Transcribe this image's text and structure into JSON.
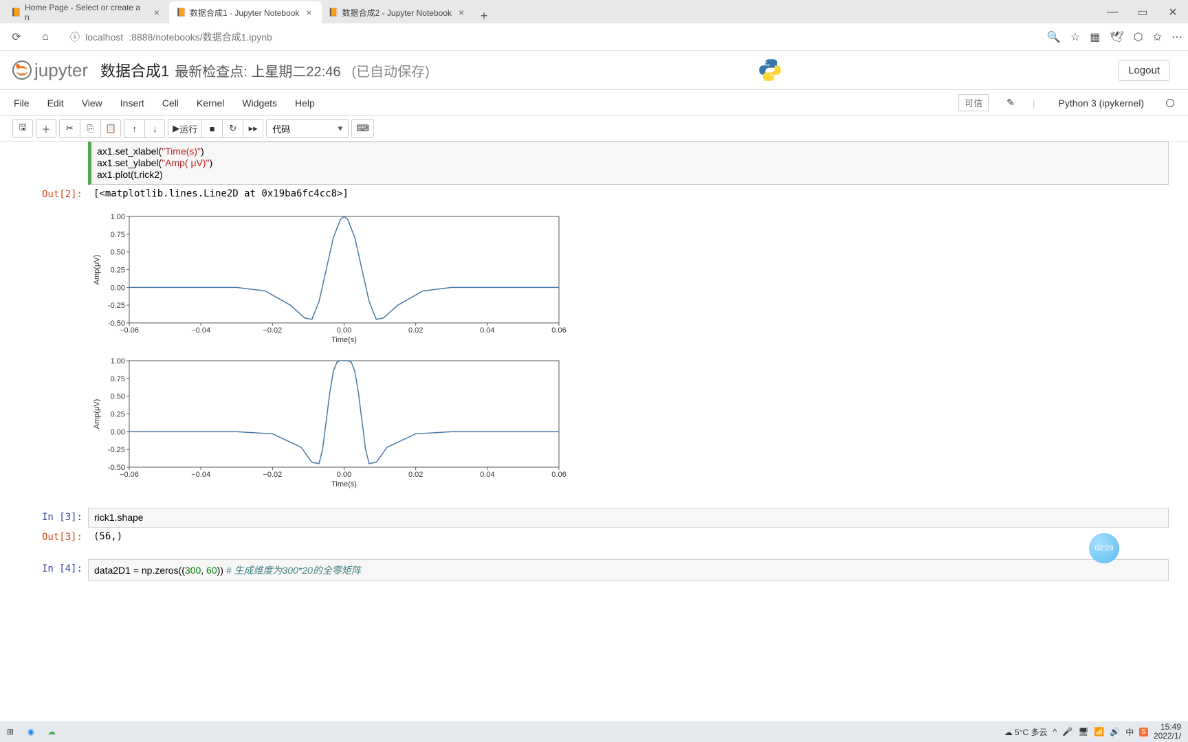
{
  "browser": {
    "tabs": [
      {
        "title": "Home Page - Select or create a n",
        "active": false,
        "icon": "jupyter"
      },
      {
        "title": "数据合成1 - Jupyter Notebook",
        "active": true,
        "icon": "jupyter"
      },
      {
        "title": "数据合成2 - Jupyter Notebook",
        "active": false,
        "icon": "jupyter"
      }
    ],
    "url_host": "localhost",
    "url_port_path": ":8888/notebooks/数据合成1.ipynb"
  },
  "jupyter": {
    "logo_text": "jupyter",
    "title": "数据合成1",
    "checkpoint": "最新检查点: 上星期二22:46",
    "autosave": "(已自动保存)",
    "logout": "Logout",
    "menu": [
      "File",
      "Edit",
      "View",
      "Insert",
      "Cell",
      "Kernel",
      "Widgets",
      "Help"
    ],
    "trusted": "可信",
    "kernel": "Python 3 (ipykernel)",
    "toolbar": {
      "run": "运行",
      "celltype": "代码"
    }
  },
  "code": {
    "line1a": "ax1.set_xlabel(",
    "str1": "\"Time(s)\"",
    "line1b": ")",
    "line2a": "ax1.set_ylabel(",
    "str2": "\"Amp( μV)\"",
    "line2b": ")",
    "line3": "ax1.plot(t,rick2)"
  },
  "prompts": {
    "out2": "Out[2]:",
    "in3": "In  [3]:",
    "out3": "Out[3]:",
    "in4": "In  [4]:"
  },
  "outputs": {
    "out2_text": "[<matplotlib.lines.Line2D at 0x19ba6fc4cc8>]",
    "out3_text": "(56,)"
  },
  "cell3_code": "rick1.shape",
  "cell4": {
    "prefix": "data2D1 = np.zeros((",
    "n1": "300",
    "comma": ", ",
    "n2": "60",
    "suffix": "))     ",
    "comment": "# 生成维度为300*20的全零矩阵"
  },
  "chart_data": [
    {
      "type": "line",
      "xlabel": "Time(s)",
      "ylabel": "Amp(μV)",
      "xlim": [
        -0.06,
        0.06
      ],
      "ylim": [
        -0.5,
        1.0
      ],
      "xticks": [
        -0.06,
        -0.04,
        -0.02,
        0.0,
        0.02,
        0.04,
        0.06
      ],
      "yticks": [
        -0.5,
        -0.25,
        0.0,
        0.25,
        0.5,
        0.75,
        1.0
      ],
      "x": [
        -0.06,
        -0.05,
        -0.04,
        -0.03,
        -0.022,
        -0.015,
        -0.011,
        -0.009,
        -0.007,
        -0.005,
        -0.003,
        -0.001,
        0.0,
        0.001,
        0.003,
        0.005,
        0.007,
        0.009,
        0.011,
        0.015,
        0.022,
        0.03,
        0.04,
        0.05,
        0.06
      ],
      "values": [
        0.0,
        0.0,
        0.0,
        0.0,
        -0.05,
        -0.25,
        -0.43,
        -0.45,
        -0.2,
        0.25,
        0.7,
        0.96,
        1.0,
        0.96,
        0.7,
        0.25,
        -0.2,
        -0.45,
        -0.43,
        -0.25,
        -0.05,
        0.0,
        0.0,
        0.0,
        0.0
      ]
    },
    {
      "type": "line",
      "xlabel": "Time(s)",
      "ylabel": "Amp(μV)",
      "xlim": [
        -0.06,
        0.06
      ],
      "ylim": [
        -0.5,
        1.0
      ],
      "xticks": [
        -0.06,
        -0.04,
        -0.02,
        0.0,
        0.02,
        0.04,
        0.06
      ],
      "yticks": [
        -0.5,
        -0.25,
        0.0,
        0.25,
        0.5,
        0.75,
        1.0
      ],
      "x": [
        -0.06,
        -0.05,
        -0.04,
        -0.03,
        -0.02,
        -0.012,
        -0.009,
        -0.007,
        -0.006,
        -0.005,
        -0.004,
        -0.003,
        -0.002,
        -0.001,
        0.0,
        0.001,
        0.002,
        0.003,
        0.004,
        0.005,
        0.006,
        0.007,
        0.009,
        0.012,
        0.02,
        0.03,
        0.04,
        0.05,
        0.06
      ],
      "values": [
        0.0,
        0.0,
        0.0,
        0.0,
        -0.03,
        -0.22,
        -0.43,
        -0.45,
        -0.25,
        0.15,
        0.55,
        0.85,
        0.98,
        1.0,
        1.0,
        1.0,
        0.98,
        0.85,
        0.55,
        0.15,
        -0.25,
        -0.45,
        -0.43,
        -0.22,
        -0.03,
        0.0,
        0.0,
        0.0,
        0.0
      ]
    }
  ],
  "taskbar": {
    "weather": "5°C 多云",
    "ime": "中",
    "time": "15:49",
    "date": "2022/1/"
  },
  "badge": "02:29"
}
